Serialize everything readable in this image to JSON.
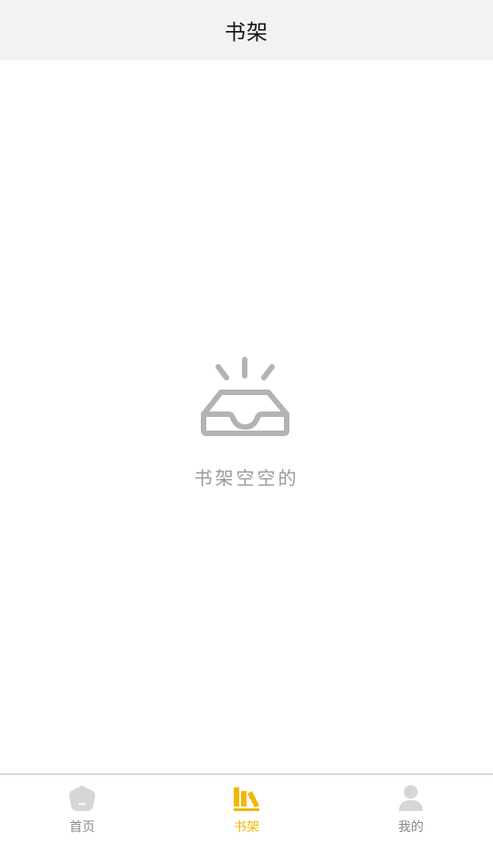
{
  "header": {
    "title": "书架"
  },
  "empty_state": {
    "icon": "empty-inbox-icon",
    "message": "书架空空的"
  },
  "tabbar": {
    "active_color": "#f2b705",
    "inactive_color": "#cccccc",
    "tabs": [
      {
        "label": "首页",
        "icon": "home-icon",
        "active": false
      },
      {
        "label": "书架",
        "icon": "bookshelf-icon",
        "active": true
      },
      {
        "label": "我的",
        "icon": "user-icon",
        "active": false
      }
    ]
  }
}
